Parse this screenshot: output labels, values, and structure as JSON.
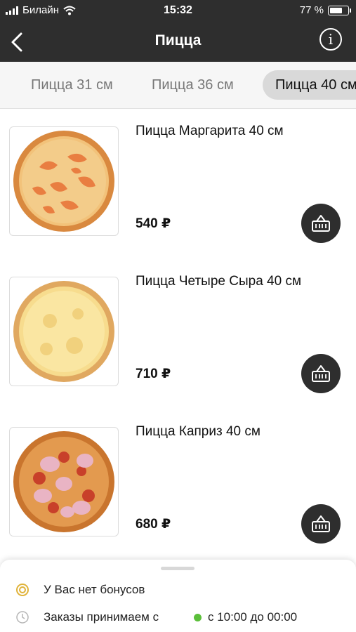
{
  "status_bar": {
    "carrier": "Билайн",
    "time": "15:32",
    "battery_percent": "77 %",
    "battery_level": 0.77
  },
  "nav": {
    "title": "Пицца"
  },
  "tabs": [
    {
      "label": "Пицца 31 см",
      "selected": false
    },
    {
      "label": "Пицца 36 см",
      "selected": false
    },
    {
      "label": "Пицца 40 см",
      "selected": true
    }
  ],
  "products": [
    {
      "name": "Пицца Маргарита 40 см",
      "price": "540 ₽"
    },
    {
      "name": "Пицца Четыре Сыра 40 см",
      "price": "710 ₽"
    },
    {
      "name": "Пицца Каприз 40 см",
      "price": "680 ₽"
    }
  ],
  "info_panel": {
    "bonus_text": "У Вас нет бонусов",
    "orders_text": "Заказы принимаем с",
    "hours_text": "с 10:00 до 00:00",
    "status_color": "#5bbf3a",
    "bonus_icon_color": "#e0b33a"
  },
  "colors": {
    "header_bg": "#2e2e2e",
    "tab_selected_bg": "#d9d9d9",
    "cart_button_bg": "#2e2e2e"
  }
}
